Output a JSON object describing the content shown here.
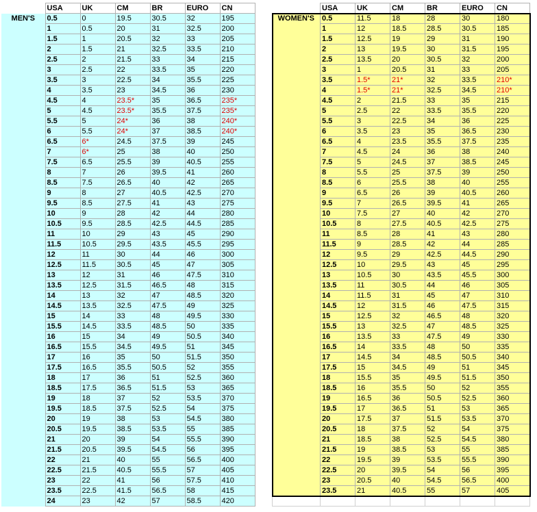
{
  "headers": [
    "USA",
    "UK",
    "CM",
    "BR",
    "EURO",
    "CN"
  ],
  "mens": {
    "label": "MEN'S",
    "rows": [
      [
        "0.5",
        "0",
        "19.5",
        "30.5",
        "32",
        "195"
      ],
      [
        "1",
        "0.5",
        "20",
        "31",
        "32.5",
        "200"
      ],
      [
        "1.5",
        "1",
        "20.5",
        "32",
        "33",
        "205"
      ],
      [
        "2",
        "1.5",
        "21",
        "32.5",
        "33.5",
        "210"
      ],
      [
        "2.5",
        "2",
        "21.5",
        "33",
        "34",
        "215"
      ],
      [
        "3",
        "2.5",
        "22",
        "33.5",
        "35",
        "220"
      ],
      [
        "3.5",
        "3",
        "22.5",
        "34",
        "35.5",
        "225"
      ],
      [
        "4",
        "3.5",
        "23",
        "34.5",
        "36",
        "230"
      ],
      [
        "4.5",
        "4",
        "23.5*",
        "35",
        "36.5",
        "235*"
      ],
      [
        "5",
        "4.5",
        "23.5*",
        "35.5",
        "37.5",
        "235*"
      ],
      [
        "5.5",
        "5",
        "24*",
        "36",
        "38",
        "240*"
      ],
      [
        "6",
        "5.5",
        "24*",
        "37",
        "38.5",
        "240*"
      ],
      [
        "6.5",
        "6*",
        "24.5",
        "37.5",
        "39",
        "245"
      ],
      [
        "7",
        "6*",
        "25",
        "38",
        "40",
        "250"
      ],
      [
        "7.5",
        "6.5",
        "25.5",
        "39",
        "40.5",
        "255"
      ],
      [
        "8",
        "7",
        "26",
        "39.5",
        "41",
        "260"
      ],
      [
        "8.5",
        "7.5",
        "26.5",
        "40",
        "42",
        "265"
      ],
      [
        "9",
        "8",
        "27",
        "40.5",
        "42.5",
        "270"
      ],
      [
        "9.5",
        "8.5",
        "27.5",
        "41",
        "43",
        "275"
      ],
      [
        "10",
        "9",
        "28",
        "42",
        "44",
        "280"
      ],
      [
        "10.5",
        "9.5",
        "28.5",
        "42.5",
        "44.5",
        "285"
      ],
      [
        "11",
        "10",
        "29",
        "43",
        "45",
        "290"
      ],
      [
        "11.5",
        "10.5",
        "29.5",
        "43.5",
        "45.5",
        "295"
      ],
      [
        "12",
        "11",
        "30",
        "44",
        "46",
        "300"
      ],
      [
        "12.5",
        "11.5",
        "30.5",
        "45",
        "47",
        "305"
      ],
      [
        "13",
        "12",
        "31",
        "46",
        "47.5",
        "310"
      ],
      [
        "13.5",
        "12.5",
        "31.5",
        "46.5",
        "48",
        "315"
      ],
      [
        "14",
        "13",
        "32",
        "47",
        "48.5",
        "320"
      ],
      [
        "14.5",
        "13.5",
        "32.5",
        "47.5",
        "49",
        "325"
      ],
      [
        "15",
        "14",
        "33",
        "48",
        "49.5",
        "330"
      ],
      [
        "15.5",
        "14.5",
        "33.5",
        "48.5",
        "50",
        "335"
      ],
      [
        "16",
        "15",
        "34",
        "49",
        "50.5",
        "340"
      ],
      [
        "16.5",
        "15.5",
        "34.5",
        "49.5",
        "51",
        "345"
      ],
      [
        "17",
        "16",
        "35",
        "50",
        "51.5",
        "350"
      ],
      [
        "17.5",
        "16.5",
        "35.5",
        "50.5",
        "52",
        "355"
      ],
      [
        "18",
        "17",
        "36",
        "51",
        "52.5",
        "360"
      ],
      [
        "18.5",
        "17.5",
        "36.5",
        "51.5",
        "53",
        "365"
      ],
      [
        "19",
        "18",
        "37",
        "52",
        "53.5",
        "370"
      ],
      [
        "19.5",
        "18.5",
        "37.5",
        "52.5",
        "54",
        "375"
      ],
      [
        "20",
        "19",
        "38",
        "53",
        "54.5",
        "380"
      ],
      [
        "20.5",
        "19.5",
        "38.5",
        "53.5",
        "55",
        "385"
      ],
      [
        "21",
        "20",
        "39",
        "54",
        "55.5",
        "390"
      ],
      [
        "21.5",
        "20.5",
        "39.5",
        "54.5",
        "56",
        "395"
      ],
      [
        "22",
        "21",
        "40",
        "55",
        "56.5",
        "400"
      ],
      [
        "22.5",
        "21.5",
        "40.5",
        "55.5",
        "57",
        "405"
      ],
      [
        "23",
        "22",
        "41",
        "56",
        "57.5",
        "410"
      ],
      [
        "23.5",
        "22.5",
        "41.5",
        "56.5",
        "58",
        "415"
      ],
      [
        "24",
        "23",
        "42",
        "57",
        "58.5",
        "420"
      ]
    ]
  },
  "womens": {
    "label": "WOMEN'S",
    "rows": [
      [
        "0.5",
        "11.5",
        "18",
        "28",
        "30",
        "180"
      ],
      [
        "1",
        "12",
        "18.5",
        "28.5",
        "30.5",
        "185"
      ],
      [
        "1.5",
        "12.5",
        "19",
        "29",
        "31",
        "190"
      ],
      [
        "2",
        "13",
        "19.5",
        "30",
        "31.5",
        "195"
      ],
      [
        "2.5",
        "13.5",
        "20",
        "30.5",
        "32",
        "200"
      ],
      [
        "3",
        "1",
        "20.5",
        "31",
        "33",
        "205"
      ],
      [
        "3.5",
        "1.5*",
        "21*",
        "32",
        "33.5",
        "210*"
      ],
      [
        "4",
        "1.5*",
        "21*",
        "32.5",
        "34.5",
        "210*"
      ],
      [
        "4.5",
        "2",
        "21.5",
        "33",
        "35",
        "215"
      ],
      [
        "5",
        "2.5",
        "22",
        "33.5",
        "35.5",
        "220"
      ],
      [
        "5.5",
        "3",
        "22.5",
        "34",
        "36",
        "225"
      ],
      [
        "6",
        "3.5",
        "23",
        "35",
        "36.5",
        "230"
      ],
      [
        "6.5",
        "4",
        "23.5",
        "35.5",
        "37.5",
        "235"
      ],
      [
        "7",
        "4.5",
        "24",
        "36",
        "38",
        "240"
      ],
      [
        "7.5",
        "5",
        "24.5",
        "37",
        "38.5",
        "245"
      ],
      [
        "8",
        "5.5",
        "25",
        "37.5",
        "39",
        "250"
      ],
      [
        "8.5",
        "6",
        "25.5",
        "38",
        "40",
        "255"
      ],
      [
        "9",
        "6.5",
        "26",
        "39",
        "40.5",
        "260"
      ],
      [
        "9.5",
        "7",
        "26.5",
        "39.5",
        "41",
        "265"
      ],
      [
        "10",
        "7.5",
        "27",
        "40",
        "42",
        "270"
      ],
      [
        "10.5",
        "8",
        "27.5",
        "40.5",
        "42.5",
        "275"
      ],
      [
        "11",
        "8.5",
        "28",
        "41",
        "43",
        "280"
      ],
      [
        "11.5",
        "9",
        "28.5",
        "42",
        "44",
        "285"
      ],
      [
        "12",
        "9.5",
        "29",
        "42.5",
        "44.5",
        "290"
      ],
      [
        "12.5",
        "10",
        "29.5",
        "43",
        "45",
        "295"
      ],
      [
        "13",
        "10.5",
        "30",
        "43.5",
        "45.5",
        "300"
      ],
      [
        "13.5",
        "11",
        "30.5",
        "44",
        "46",
        "305"
      ],
      [
        "14",
        "11.5",
        "31",
        "45",
        "47",
        "310"
      ],
      [
        "14.5",
        "12",
        "31.5",
        "46",
        "47.5",
        "315"
      ],
      [
        "15",
        "12.5",
        "32",
        "46.5",
        "48",
        "320"
      ],
      [
        "15.5",
        "13",
        "32.5",
        "47",
        "48.5",
        "325"
      ],
      [
        "16",
        "13.5",
        "33",
        "47.5",
        "49",
        "330"
      ],
      [
        "16.5",
        "14",
        "33.5",
        "48",
        "50",
        "335"
      ],
      [
        "17",
        "14.5",
        "34",
        "48.5",
        "50.5",
        "340"
      ],
      [
        "17.5",
        "15",
        "34.5",
        "49",
        "51",
        "345"
      ],
      [
        "18",
        "15.5",
        "35",
        "49.5",
        "51.5",
        "350"
      ],
      [
        "18.5",
        "16",
        "35.5",
        "50",
        "52",
        "355"
      ],
      [
        "19",
        "16.5",
        "36",
        "50.5",
        "52.5",
        "360"
      ],
      [
        "19.5",
        "17",
        "36.5",
        "51",
        "53",
        "365"
      ],
      [
        "20",
        "17.5",
        "37",
        "51.5",
        "53.5",
        "370"
      ],
      [
        "20.5",
        "18",
        "37.5",
        "52",
        "54",
        "375"
      ],
      [
        "21",
        "18.5",
        "38",
        "52.5",
        "54.5",
        "380"
      ],
      [
        "21.5",
        "19",
        "38.5",
        "53",
        "55",
        "385"
      ],
      [
        "22",
        "19.5",
        "39",
        "53.5",
        "55.5",
        "390"
      ],
      [
        "22.5",
        "20",
        "39.5",
        "54",
        "56",
        "395"
      ],
      [
        "23",
        "20.5",
        "40",
        "54.5",
        "56.5",
        "400"
      ],
      [
        "23.5",
        "21",
        "40.5",
        "55",
        "57",
        "405"
      ]
    ]
  },
  "colors": {
    "mens_fill": "#ccffff",
    "womens_fill": "#ffff99",
    "asterisk_text": "#e00000"
  }
}
